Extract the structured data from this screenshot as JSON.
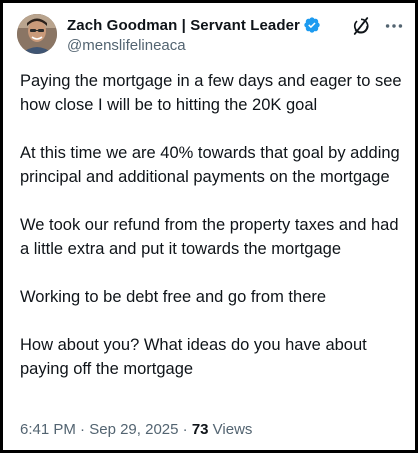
{
  "author": {
    "display_name": "Zach Goodman | Servant Leader",
    "handle": "@menslifelineaca",
    "verified": true,
    "verified_color": "#1d9bf0"
  },
  "icons": {
    "avatar": "profile-photo",
    "verified": "verified-badge-icon",
    "grok": "grok-icon",
    "more": "more-horizontal-icon"
  },
  "tweet": {
    "paragraphs": [
      "Paying the mortgage in a few days and eager to see how close I will be to hitting the 20K goal",
      "At this time we are 40% towards that goal by adding principal and additional payments on the mortgage",
      "We took our refund from the property taxes and had a little extra and put it towards the mortgage",
      "Working to be debt free and go from there",
      "How about you? What ideas do you have about paying off the mortgage"
    ]
  },
  "meta": {
    "time": "6:41 PM",
    "separator1": " · ",
    "date": "Sep 29, 2025",
    "separator2": " · ",
    "views_count": "73",
    "views_label": " Views"
  },
  "colors": {
    "text": "#0f1419",
    "secondary": "#536471",
    "border": "#000000"
  }
}
